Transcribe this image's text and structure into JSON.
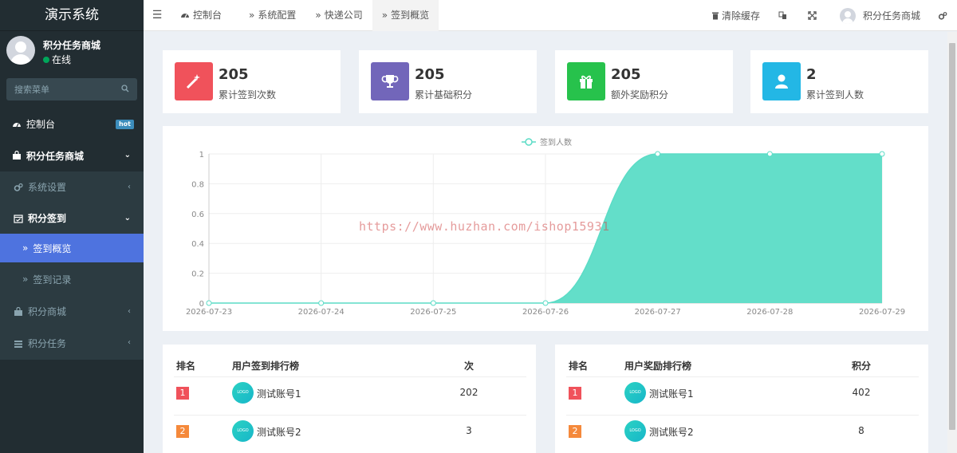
{
  "app": {
    "title": "演示系统"
  },
  "user": {
    "name": "积分任务商城",
    "status": "在线"
  },
  "search": {
    "placeholder": "搜索菜单"
  },
  "sidebar": {
    "items": [
      {
        "label": "控制台",
        "badge": "hot"
      },
      {
        "label": "积分任务商城"
      },
      {
        "label": "系统设置"
      },
      {
        "label": "积分签到"
      },
      {
        "label": "签到概览"
      },
      {
        "label": "签到记录"
      },
      {
        "label": "积分商城"
      },
      {
        "label": "积分任务"
      }
    ]
  },
  "topbar": {
    "tabs": [
      {
        "label": "控制台"
      },
      {
        "label": "系统配置"
      },
      {
        "label": "快递公司"
      },
      {
        "label": "签到概览"
      }
    ],
    "clear_cache": "清除缓存",
    "user_name": "积分任务商城"
  },
  "stats": [
    {
      "value": "205",
      "label": "累计签到次数",
      "color": "#f0525b",
      "icon": "magic-wand-icon"
    },
    {
      "value": "205",
      "label": "累计基础积分",
      "color": "#7266ba",
      "icon": "trophy-icon"
    },
    {
      "value": "205",
      "label": "额外奖励积分",
      "color": "#27c24c",
      "icon": "gift-icon"
    },
    {
      "value": "2",
      "label": "累计签到人数",
      "color": "#23b7e5",
      "icon": "user-icon"
    }
  ],
  "chart_data": {
    "type": "area",
    "x": [
      "2026-07-23",
      "2026-07-24",
      "2026-07-25",
      "2026-07-26",
      "2026-07-27",
      "2026-07-28",
      "2026-07-29"
    ],
    "series": [
      {
        "name": "签到人数",
        "values": [
          0,
          0,
          0,
          0,
          1,
          1,
          1
        ],
        "color": "#5bdcc6"
      }
    ],
    "ylim": [
      0,
      1
    ],
    "yticks": [
      "0",
      "0.2",
      "0.4",
      "0.6",
      "0.8",
      "1"
    ],
    "legend": "top-center",
    "grid": true,
    "smooth": true
  },
  "rank_checkin": {
    "col_rank": "排名",
    "col_user": "用户签到排行榜",
    "col_value": "次",
    "rows": [
      {
        "rank": "1",
        "logo": "LOGO",
        "user": "测试账号1",
        "value": "202"
      },
      {
        "rank": "2",
        "logo": "LOGO",
        "user": "测试账号2",
        "value": "3"
      }
    ]
  },
  "rank_reward": {
    "col_rank": "排名",
    "col_user": "用户奖励排行榜",
    "col_value": "积分",
    "rows": [
      {
        "rank": "1",
        "logo": "LOGO",
        "user": "测试账号1",
        "value": "402"
      },
      {
        "rank": "2",
        "logo": "LOGO",
        "user": "测试账号2",
        "value": "8"
      }
    ]
  },
  "rank_colors": [
    "#f0525b",
    "#f5893b"
  ],
  "watermark": "https://www.huzhan.com/ishop15931"
}
